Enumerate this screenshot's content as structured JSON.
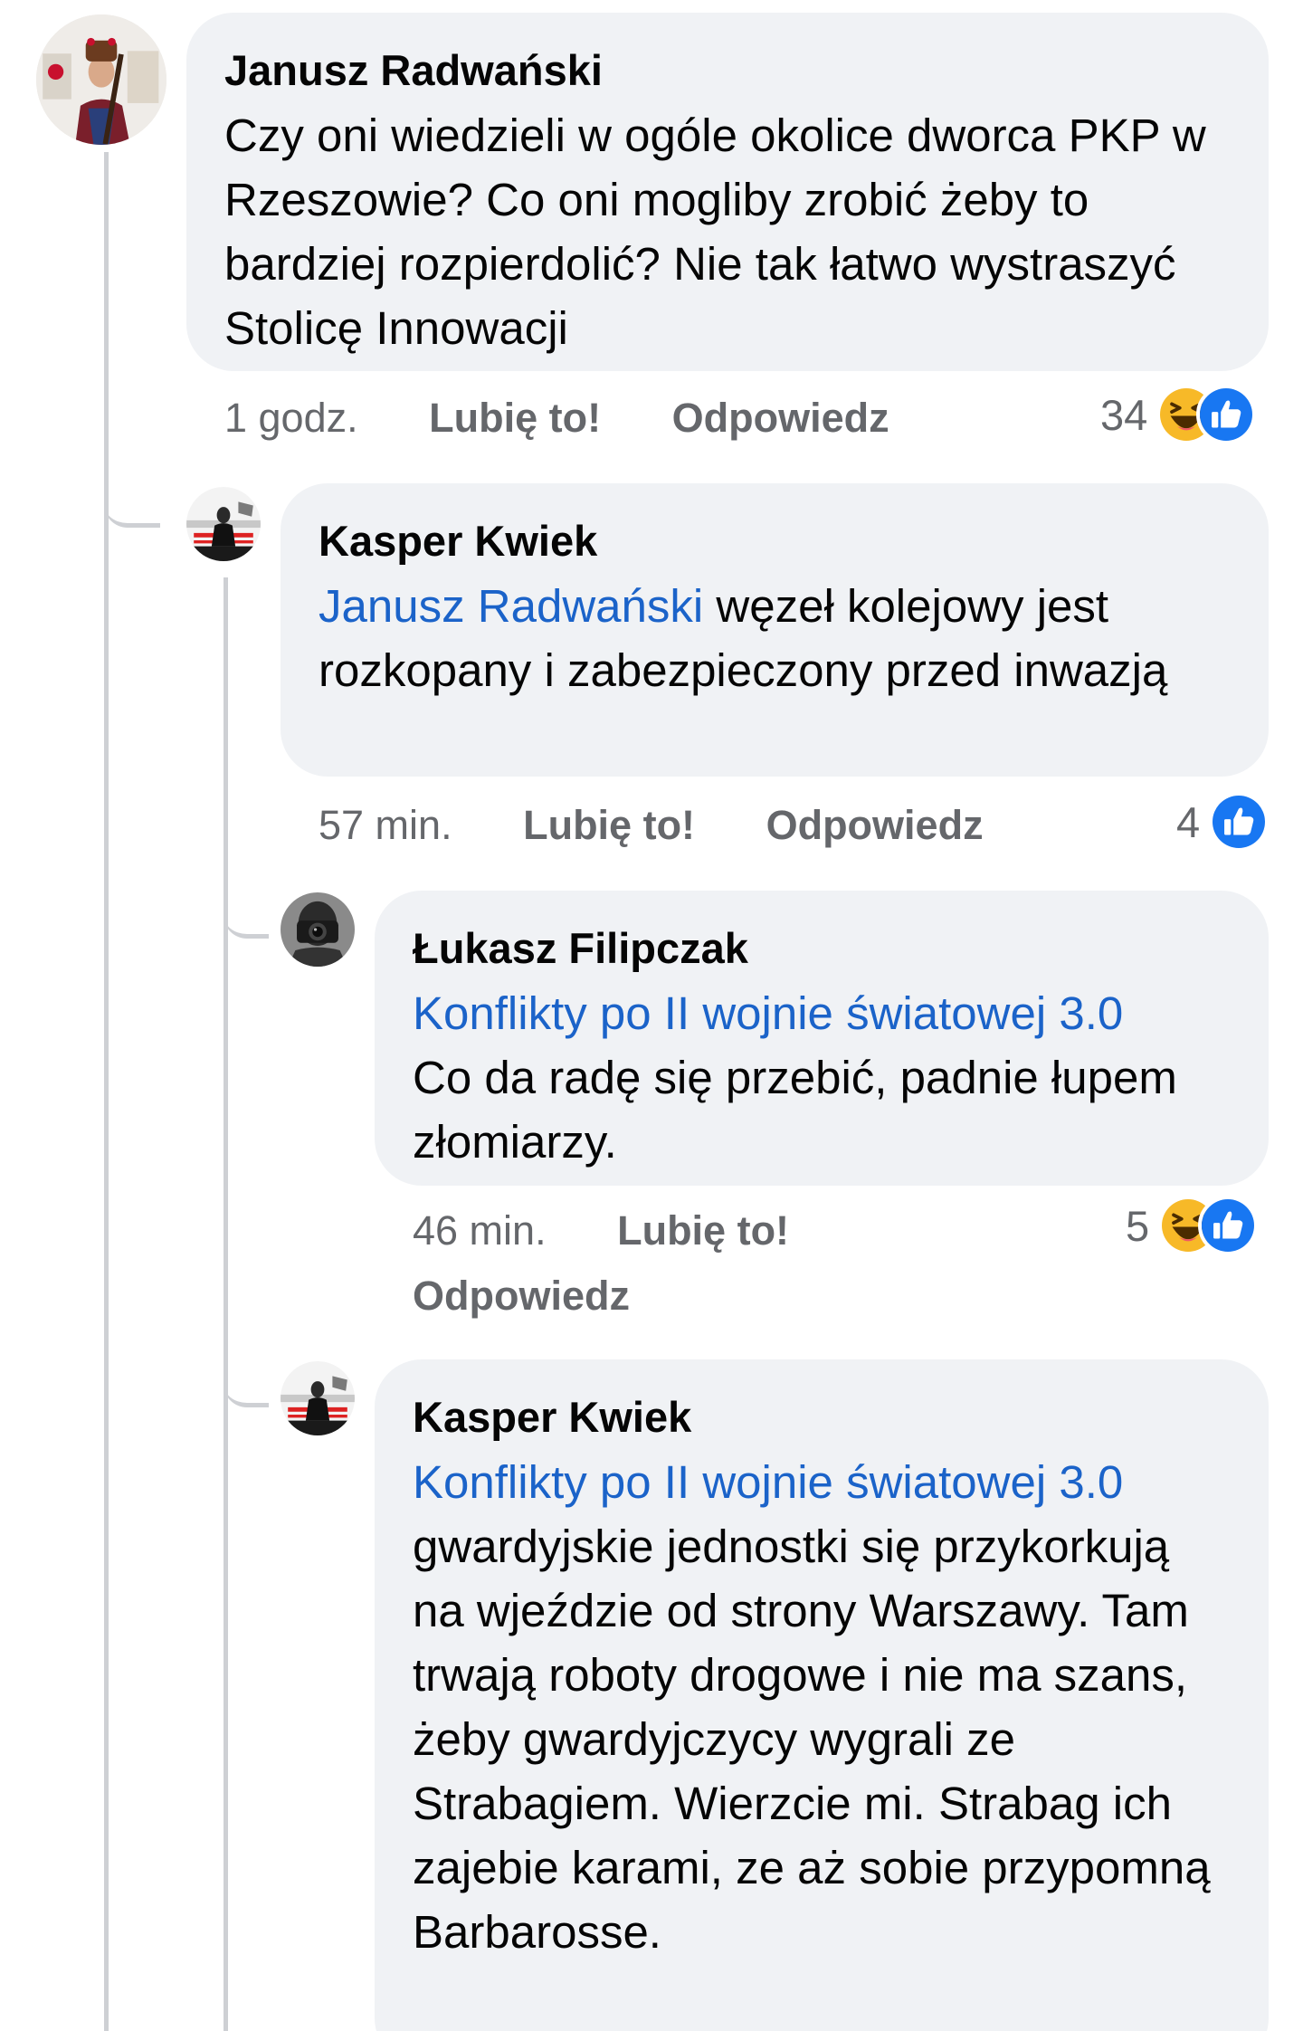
{
  "comments": [
    {
      "author": "Janusz Radwański",
      "text": "Czy oni wiedzieli w ogóle okolice dworca PKP w Rzeszowie? Co oni mogliby zrobić żeby to bardziej rozpierdolić? Nie tak łatwo wystraszyć Stolicę Innowacji",
      "time": "1 godz.",
      "like_label": "Lubię to!",
      "reply_label": "Odpowiedz",
      "reaction_count": "34",
      "reactions": [
        "haha-icon",
        "like-icon"
      ]
    },
    {
      "author": "Kasper Kwiek",
      "mention": "Janusz Radwański",
      "text": " węzeł kolejowy jest rozkopany i zabezpieczony przed inwazją",
      "time": "57 min.",
      "like_label": "Lubię to!",
      "reply_label": "Odpowiedz",
      "reaction_count": "4",
      "reactions": [
        "like-icon"
      ]
    },
    {
      "author": "Łukasz Filipczak",
      "mention": "Konflikty po II wojnie światowej 3.0",
      "text": "Co da radę się przebić, padnie łupem złomiarzy.",
      "time": "46 min.",
      "like_label": "Lubię to!",
      "reply_label": "Odpowiedz",
      "reaction_count": "5",
      "reactions": [
        "haha-icon",
        "like-icon"
      ]
    },
    {
      "author": "Kasper Kwiek",
      "mention": "Konflikty po II wojnie światowej 3.0",
      "text": "gwardyjskie jednostki się przykorkują na wjeździe od strony Warszawy. Tam trwają roboty drogowe i nie ma szans, żeby gwardyjczycy wygrali ze Strabagiem. Wierzcie mi. Strabag ich zajebie karami, ze aż sobie przypomną Barbarosse."
    }
  ],
  "colors": {
    "bubble": "#f0f2f5",
    "mention": "#1b63c9",
    "meta": "#65676b",
    "like": "#1877f2",
    "haha": "#f7b928"
  }
}
